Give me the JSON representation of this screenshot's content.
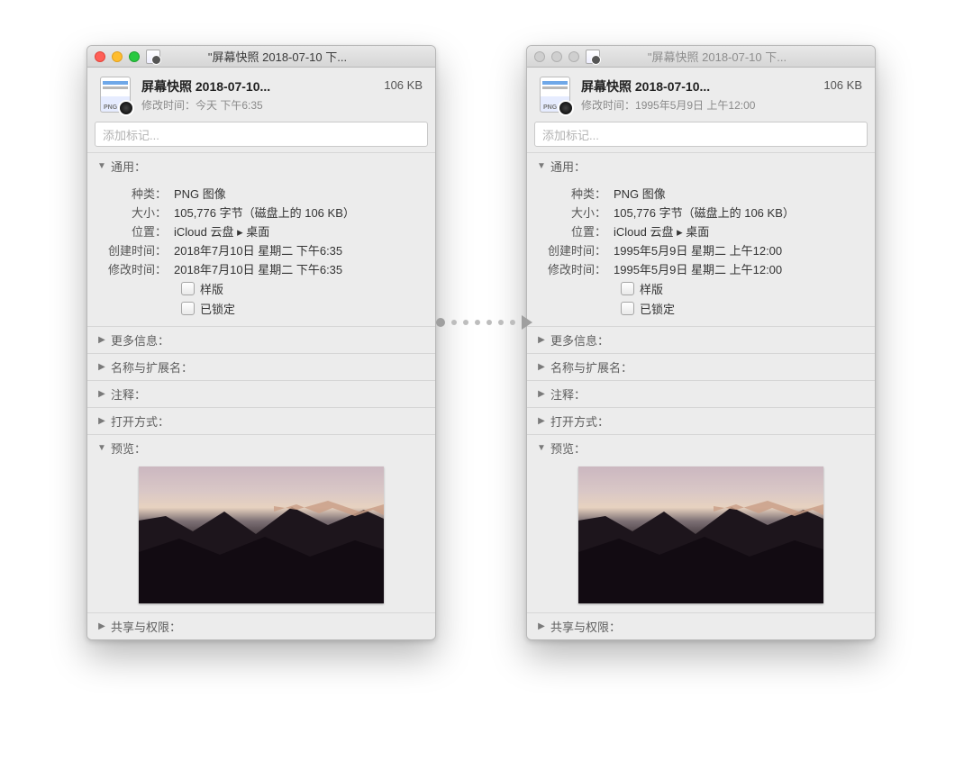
{
  "left": {
    "window_title": "\"屏幕快照 2018-07-10 下...",
    "filename": "屏幕快照 2018-07-10...",
    "filesize": "106 KB",
    "modified_label": "修改时间：",
    "modified_short": "今天 下午6:35",
    "tags_placeholder": "添加标记...",
    "sections": {
      "general": "通用：",
      "more": "更多信息：",
      "nameext": "名称与扩展名：",
      "comments": "注释：",
      "openwith": "打开方式：",
      "preview": "预览：",
      "sharing": "共享与权限："
    },
    "kv": {
      "kind_label": "种类：",
      "kind_val": "PNG 图像",
      "size_label": "大小：",
      "size_val": "105,776 字节（磁盘上的 106 KB）",
      "where_label": "位置：",
      "where_val": "iCloud 云盘 ▸ 桌面",
      "created_label": "创建时间：",
      "created_val": "2018年7月10日 星期二 下午6:35",
      "modified_label": "修改时间：",
      "modified_val": "2018年7月10日 星期二 下午6:35"
    },
    "checks": {
      "stationery": "样版",
      "locked": "已锁定"
    },
    "png_tag": "PNG"
  },
  "right": {
    "window_title": "\"屏幕快照 2018-07-10 下...",
    "filename": "屏幕快照 2018-07-10...",
    "filesize": "106 KB",
    "modified_label": "修改时间：",
    "modified_short": "1995年5月9日 上午12:00",
    "tags_placeholder": "添加标记...",
    "sections": {
      "general": "通用：",
      "more": "更多信息：",
      "nameext": "名称与扩展名：",
      "comments": "注释：",
      "openwith": "打开方式：",
      "preview": "预览：",
      "sharing": "共享与权限："
    },
    "kv": {
      "kind_label": "种类：",
      "kind_val": "PNG 图像",
      "size_label": "大小：",
      "size_val": "105,776 字节（磁盘上的 106 KB）",
      "where_label": "位置：",
      "where_val": "iCloud 云盘 ▸ 桌面",
      "created_label": "创建时间：",
      "created_val": "1995年5月9日 星期二 上午12:00",
      "modified_label": "修改时间：",
      "modified_val": "1995年5月9日 星期二 上午12:00"
    },
    "checks": {
      "stationery": "样版",
      "locked": "已锁定"
    },
    "png_tag": "PNG"
  }
}
